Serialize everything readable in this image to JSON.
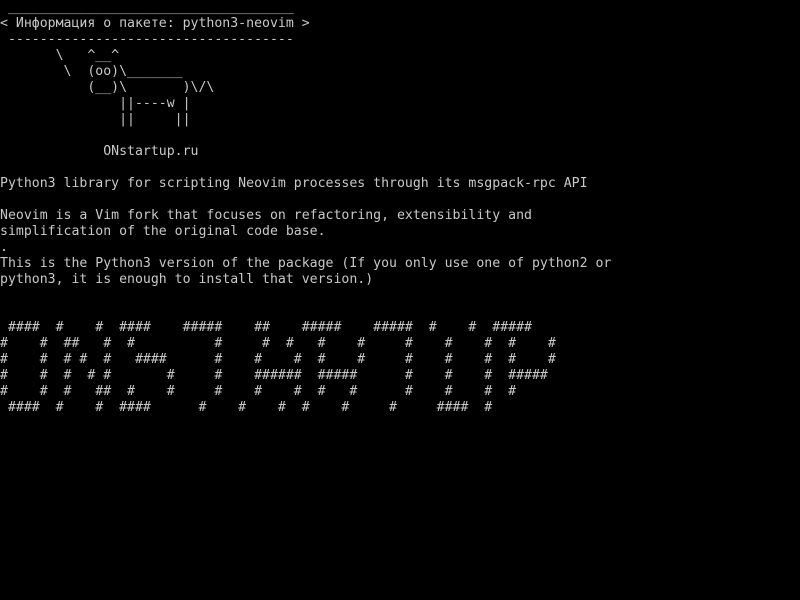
{
  "terminal": {
    "colors": {
      "background": "#000000",
      "foreground": "#c8c8c8"
    },
    "lines": [
      " ____________________________________",
      "< Информация о пакете: python3-neovim >",
      " ------------------------------------",
      "       \\   ^__^",
      "        \\  (oo)\\_______",
      "           (__)\\       )\\/\\",
      "               ||----w |",
      "               ||     ||",
      "",
      "             ONstartup.ru",
      "",
      "Python3 library for scripting Neovim processes through its msgpack-rpc API",
      "",
      "Neovim is a Vim fork that focuses on refactoring, extensibility and",
      "simplification of the original code base.",
      ".",
      "This is the Python3 version of the package (If you only use one of python2 or",
      "python3, it is enough to install that version.)",
      "",
      "",
      " ####  #    #  ####    #####    ##    #####    #####  #    #  #####",
      "#    #  ##   #  #          #     #  #   #    #     #    #    #  #    #",
      "#    #  # #  #   ####      #    #    #  #    #     #    #    #  #    #",
      "#    #  #  # #       #     #    ######  #####      #    #    #  #####",
      "#    #  #   ##  #    #     #    #    #  #   #      #    #    #  #",
      " ####  #    #  ####      #    #    #  #    #     #     ####  #"
    ]
  }
}
